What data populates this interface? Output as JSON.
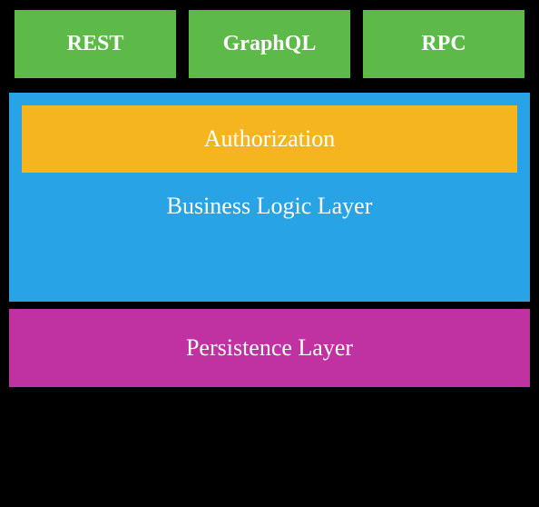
{
  "api_endpoints": {
    "rest": "REST",
    "graphql": "GraphQL",
    "rpc": "RPC"
  },
  "authorization_label": "Authorization",
  "business_logic_label": "Business Logic Layer",
  "persistence_label": "Persistence Layer",
  "colors": {
    "api_green": "#5eba48",
    "business_blue": "#28a3e6",
    "auth_yellow": "#f5b51e",
    "persistence_magenta": "#c031a2",
    "background": "#000000"
  }
}
